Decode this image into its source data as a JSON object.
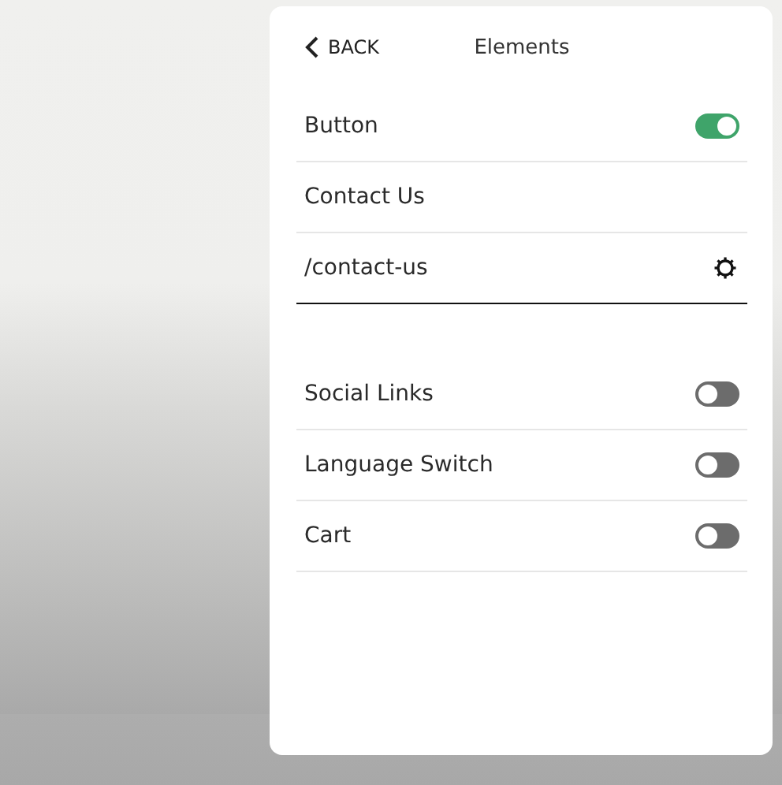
{
  "header": {
    "back": "BACK",
    "title": "Elements"
  },
  "button_section": {
    "label": "Button",
    "on": true,
    "text": "Contact Us",
    "link": "/contact-us"
  },
  "toggles": [
    {
      "label": "Social Links",
      "on": false
    },
    {
      "label": "Language Switch",
      "on": false
    },
    {
      "label": "Cart",
      "on": false
    }
  ]
}
